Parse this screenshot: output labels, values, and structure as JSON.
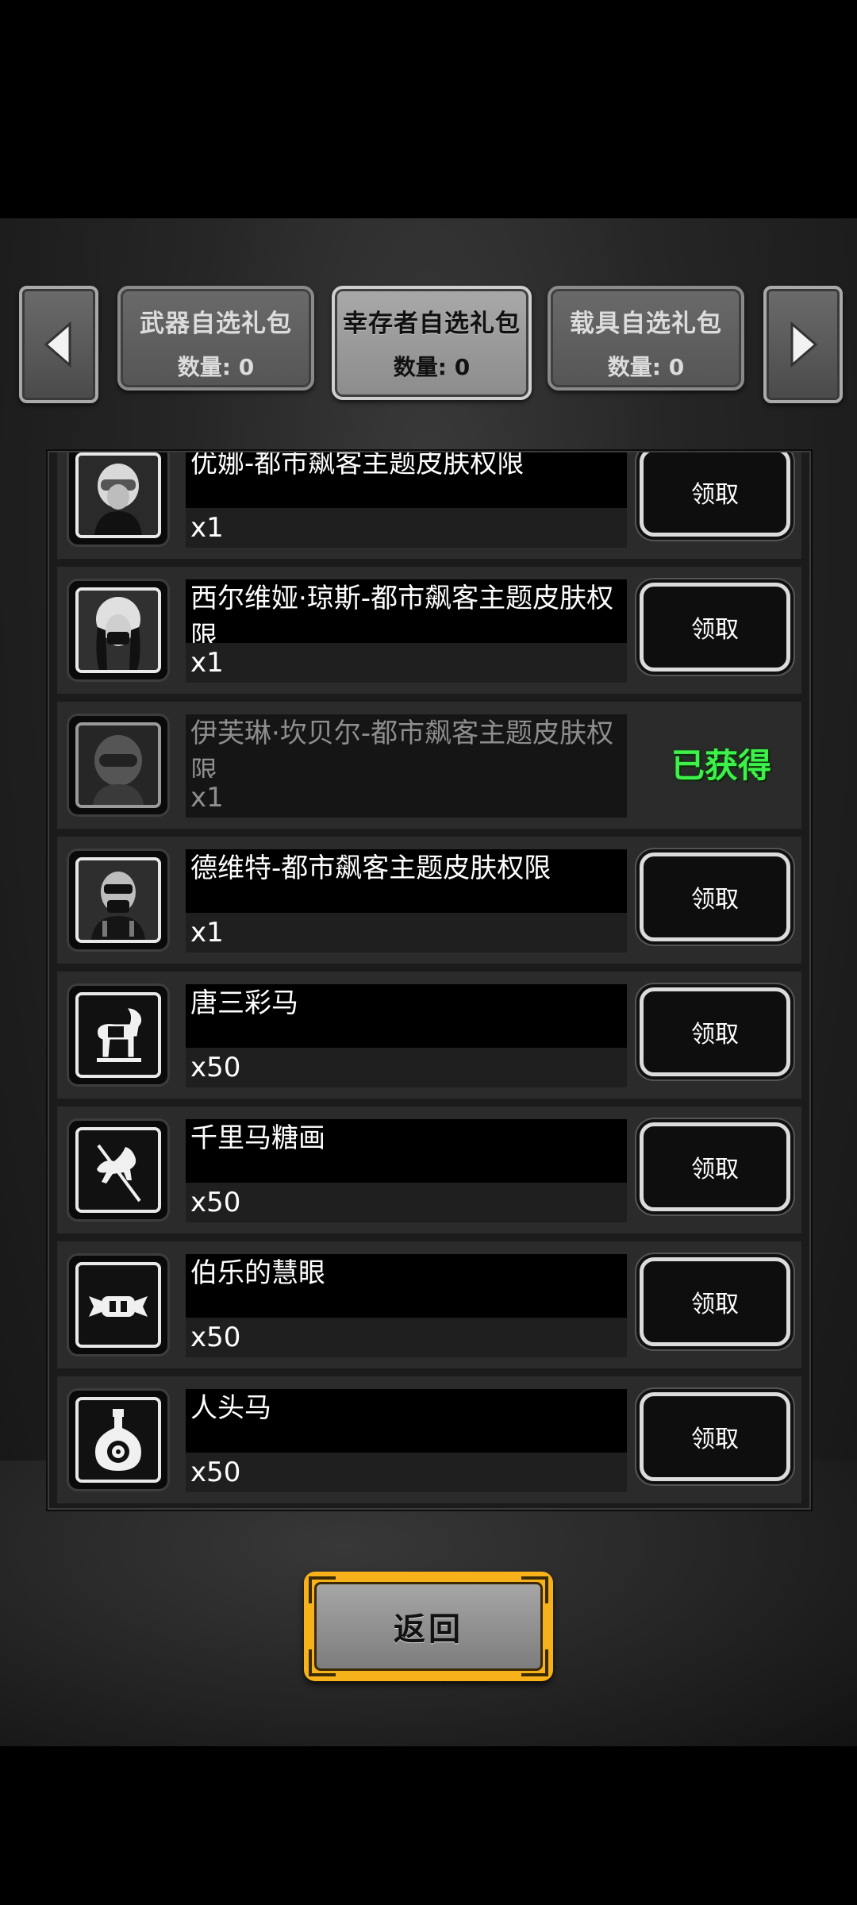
{
  "tabs": [
    {
      "title": "武器自选礼包",
      "count": "数量: 0",
      "active": false
    },
    {
      "title": "幸存者自选礼包",
      "count": "数量: 0",
      "active": true
    },
    {
      "title": "载具自选礼包",
      "count": "数量: 0",
      "active": false
    }
  ],
  "items": [
    {
      "name": "优娜-都市飙客主题皮肤权限",
      "qty": "x1",
      "action": "领取",
      "icon": "helmet-woman-portrait"
    },
    {
      "name": "西尔维娅·琼斯-都市飙客主题皮肤权限",
      "qty": "x1",
      "action": "领取",
      "icon": "masked-woman-portrait"
    },
    {
      "name": "伊芙琳·坎贝尔-都市飙客主题皮肤权限",
      "qty": "x1",
      "action": "已获得",
      "icon": "full-helmet-portrait"
    },
    {
      "name": "德维特-都市飙客主题皮肤权限",
      "qty": "x1",
      "action": "领取",
      "icon": "masked-man-portrait"
    },
    {
      "name": "唐三彩马",
      "qty": "x50",
      "action": "领取",
      "icon": "horse-statue-icon"
    },
    {
      "name": "千里马糖画",
      "qty": "x50",
      "action": "领取",
      "icon": "sugar-horse-icon"
    },
    {
      "name": "伯乐的慧眼",
      "qty": "x50",
      "action": "领取",
      "icon": "candy-icon"
    },
    {
      "name": "人头马",
      "qty": "x50",
      "action": "领取",
      "icon": "cognac-bottle-icon"
    }
  ],
  "back_label": "返回"
}
